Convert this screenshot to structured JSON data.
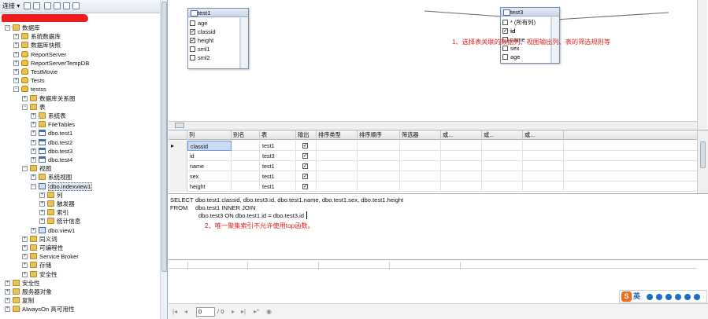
{
  "explorer": {
    "toolbar": {
      "connect_label": "连接 ▾"
    },
    "tree": [
      {
        "label": "数据库",
        "depth": 1,
        "icon": "folder",
        "expanded": true
      },
      {
        "label": "系统数据库",
        "depth": 2,
        "icon": "folder",
        "expanded": false
      },
      {
        "label": "数据库快照",
        "depth": 2,
        "icon": "folder",
        "expanded": false
      },
      {
        "label": "ReportServer",
        "depth": 2,
        "icon": "db",
        "expanded": false
      },
      {
        "label": "ReportServerTempDB",
        "depth": 2,
        "icon": "db",
        "expanded": false
      },
      {
        "label": "TestMovie",
        "depth": 2,
        "icon": "db",
        "expanded": false
      },
      {
        "label": "Tests",
        "depth": 2,
        "icon": "db",
        "expanded": false
      },
      {
        "label": "testss",
        "depth": 2,
        "icon": "db",
        "expanded": true
      },
      {
        "label": "数据库关系图",
        "depth": 3,
        "icon": "folder",
        "expanded": false
      },
      {
        "label": "表",
        "depth": 3,
        "icon": "folder",
        "expanded": true
      },
      {
        "label": "系统表",
        "depth": 4,
        "icon": "folder",
        "expanded": false
      },
      {
        "label": "FileTables",
        "depth": 4,
        "icon": "folder",
        "expanded": false
      },
      {
        "label": "dbo.test1",
        "depth": 4,
        "icon": "table",
        "expanded": false
      },
      {
        "label": "dbo.test2",
        "depth": 4,
        "icon": "table",
        "expanded": false
      },
      {
        "label": "dbo.test3",
        "depth": 4,
        "icon": "table",
        "expanded": false
      },
      {
        "label": "dbo.test4",
        "depth": 4,
        "icon": "table",
        "expanded": false
      },
      {
        "label": "视图",
        "depth": 3,
        "icon": "folder",
        "expanded": true
      },
      {
        "label": "系统视图",
        "depth": 4,
        "icon": "folder",
        "expanded": false
      },
      {
        "label": "dbo.indexview1",
        "depth": 4,
        "icon": "view",
        "expanded": true,
        "selected": true
      },
      {
        "label": "列",
        "depth": 5,
        "icon": "folder",
        "expanded": false
      },
      {
        "label": "触发器",
        "depth": 5,
        "icon": "folder",
        "expanded": false
      },
      {
        "label": "索引",
        "depth": 5,
        "icon": "folder",
        "expanded": false
      },
      {
        "label": "统计信息",
        "depth": 5,
        "icon": "folder",
        "expanded": false
      },
      {
        "label": "dbo.view1",
        "depth": 4,
        "icon": "view",
        "expanded": false
      },
      {
        "label": "同义词",
        "depth": 3,
        "icon": "folder",
        "expanded": false
      },
      {
        "label": "可编程性",
        "depth": 3,
        "icon": "folder",
        "expanded": false
      },
      {
        "label": "Service Broker",
        "depth": 3,
        "icon": "folder",
        "expanded": false
      },
      {
        "label": "存储",
        "depth": 3,
        "icon": "folder",
        "expanded": false
      },
      {
        "label": "安全性",
        "depth": 3,
        "icon": "folder",
        "expanded": false
      },
      {
        "label": "安全性",
        "depth": 1,
        "icon": "folder",
        "expanded": false
      },
      {
        "label": "服务器对象",
        "depth": 1,
        "icon": "folder",
        "expanded": false
      },
      {
        "label": "复制",
        "depth": 1,
        "icon": "folder",
        "expanded": false
      },
      {
        "label": "AlwaysOn 高可用性",
        "depth": 1,
        "icon": "folder",
        "expanded": false
      }
    ]
  },
  "diagram": {
    "table1": {
      "title": "test1",
      "columns": [
        {
          "name": "age",
          "checked": false
        },
        {
          "name": "classid",
          "checked": true
        },
        {
          "name": "height",
          "checked": true
        },
        {
          "name": "sml1",
          "checked": false
        },
        {
          "name": "sml2",
          "checked": false
        }
      ]
    },
    "table3": {
      "title": "test3",
      "columns": [
        {
          "name": "* (所有列)",
          "checked": false
        },
        {
          "name": "id",
          "checked": true,
          "bold": true
        },
        {
          "name": "name",
          "checked": false
        },
        {
          "name": "sex",
          "checked": false
        },
        {
          "name": "age",
          "checked": false
        }
      ]
    },
    "annotation": "1、选择表关联的数据列、视图输出列、表的筛选规则等"
  },
  "grid": {
    "headers": [
      "列",
      "别名",
      "表",
      "输出",
      "排序类型",
      "排序顺序",
      "筛选器",
      "或...",
      "或...",
      "或..."
    ],
    "rows": [
      {
        "column": "classid",
        "alias": "",
        "table": "test1",
        "output": true,
        "selected": true
      },
      {
        "column": "id",
        "alias": "",
        "table": "test3",
        "output": true
      },
      {
        "column": "name",
        "alias": "",
        "table": "test1",
        "output": true
      },
      {
        "column": "sex",
        "alias": "",
        "table": "test1",
        "output": true
      },
      {
        "column": "height",
        "alias": "",
        "table": "test1",
        "output": true
      }
    ]
  },
  "sql": {
    "line1_kw": "SELECT",
    "line1": "dbo.test1.classid, dbo.test3.id, dbo.test1.name, dbo.test1.sex, dbo.test1.height",
    "line2_kw": "FROM",
    "line2": "dbo.test1 INNER JOIN",
    "line3": "dbo.test3 ON dbo.test1.id = dbo.test3.id",
    "annotation": "2、唯一聚集索引不允许使用top函数。"
  },
  "navbar": {
    "page_value": "0",
    "page_total": "/ 0"
  },
  "ime": {
    "lang_label": "英"
  },
  "colors": {
    "annotation": "#e02020",
    "selection": "#c9dbf4",
    "tree_accent": "#e9c15b"
  }
}
